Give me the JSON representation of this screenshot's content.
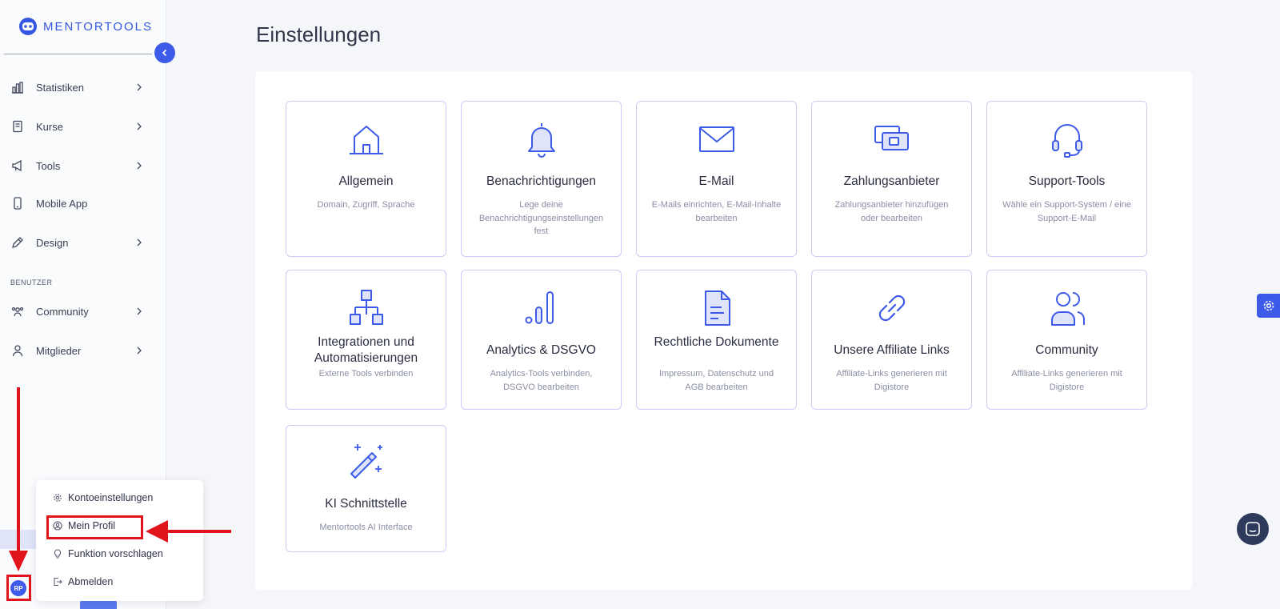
{
  "app": {
    "logo_text": "MENTORTOOLS"
  },
  "sidebar": {
    "items": [
      {
        "label": "Statistiken",
        "icon": "bar-chart-icon",
        "has_chevron": true
      },
      {
        "label": "Kurse",
        "icon": "book-icon",
        "has_chevron": true
      },
      {
        "label": "Tools",
        "icon": "megaphone-icon",
        "has_chevron": true
      },
      {
        "label": "Mobile App",
        "icon": "smartphone-icon",
        "has_chevron": false
      },
      {
        "label": "Design",
        "icon": "pencil-icon",
        "has_chevron": true
      }
    ],
    "section_label": "BENUTZER",
    "user_items": [
      {
        "label": "Community",
        "icon": "users-icon",
        "has_chevron": true
      },
      {
        "label": "Mitglieder",
        "icon": "user-icon",
        "has_chevron": true
      }
    ]
  },
  "user_menu": {
    "items": [
      {
        "label": "Kontoeinstellungen",
        "icon": "gear-icon"
      },
      {
        "label": "Mein Profil",
        "icon": "user-circle-icon"
      },
      {
        "label": "Funktion vorschlagen",
        "icon": "lightbulb-icon"
      },
      {
        "label": "Abmelden",
        "icon": "logout-icon"
      }
    ],
    "avatar_initials": "RP"
  },
  "main": {
    "title": "Einstellungen",
    "cards": [
      {
        "title": "Allgemein",
        "description": "Domain, Zugriff, Sprache",
        "icon": "home-icon"
      },
      {
        "title": "Benachrichtigungen",
        "description": "Lege deine Benachrichtigungseinstellungen fest",
        "icon": "bell-icon"
      },
      {
        "title": "E-Mail",
        "description": "E-Mails einrichten, E-Mail-Inhalte bearbeiten",
        "icon": "envelope-icon"
      },
      {
        "title": "Zahlungsanbieter",
        "description": "Zahlungsanbieter hinzufügen oder bearbeiten",
        "icon": "payment-icon"
      },
      {
        "title": "Support-Tools",
        "description": "Wähle ein Support-System / eine Support-E-Mail",
        "icon": "headset-icon"
      },
      {
        "title": "Integrationen und Automatisierungen",
        "description": "Externe Tools verbinden",
        "icon": "sitemap-icon"
      },
      {
        "title": "Analytics & DSGVO",
        "description": "Analytics-Tools verbinden, DSGVO bearbeiten",
        "icon": "analytics-icon"
      },
      {
        "title": "Rechtliche Dokumente",
        "description": "Impressum, Datenschutz und AGB bearbeiten",
        "icon": "document-icon"
      },
      {
        "title": "Unsere Affiliate Links",
        "description": "Affiliate-Links generieren mit Digistore",
        "icon": "link-icon"
      },
      {
        "title": "Community",
        "description": "Affiliate-Links generieren mit Digistore",
        "icon": "users-icon"
      },
      {
        "title": "KI Schnittstelle",
        "description": "Mentortools AI Interface",
        "icon": "magic-wand-icon"
      }
    ]
  },
  "colors": {
    "accent": "#3d5be8",
    "card_border": "#c9cdf7",
    "annotation_red": "#e0141b"
  }
}
